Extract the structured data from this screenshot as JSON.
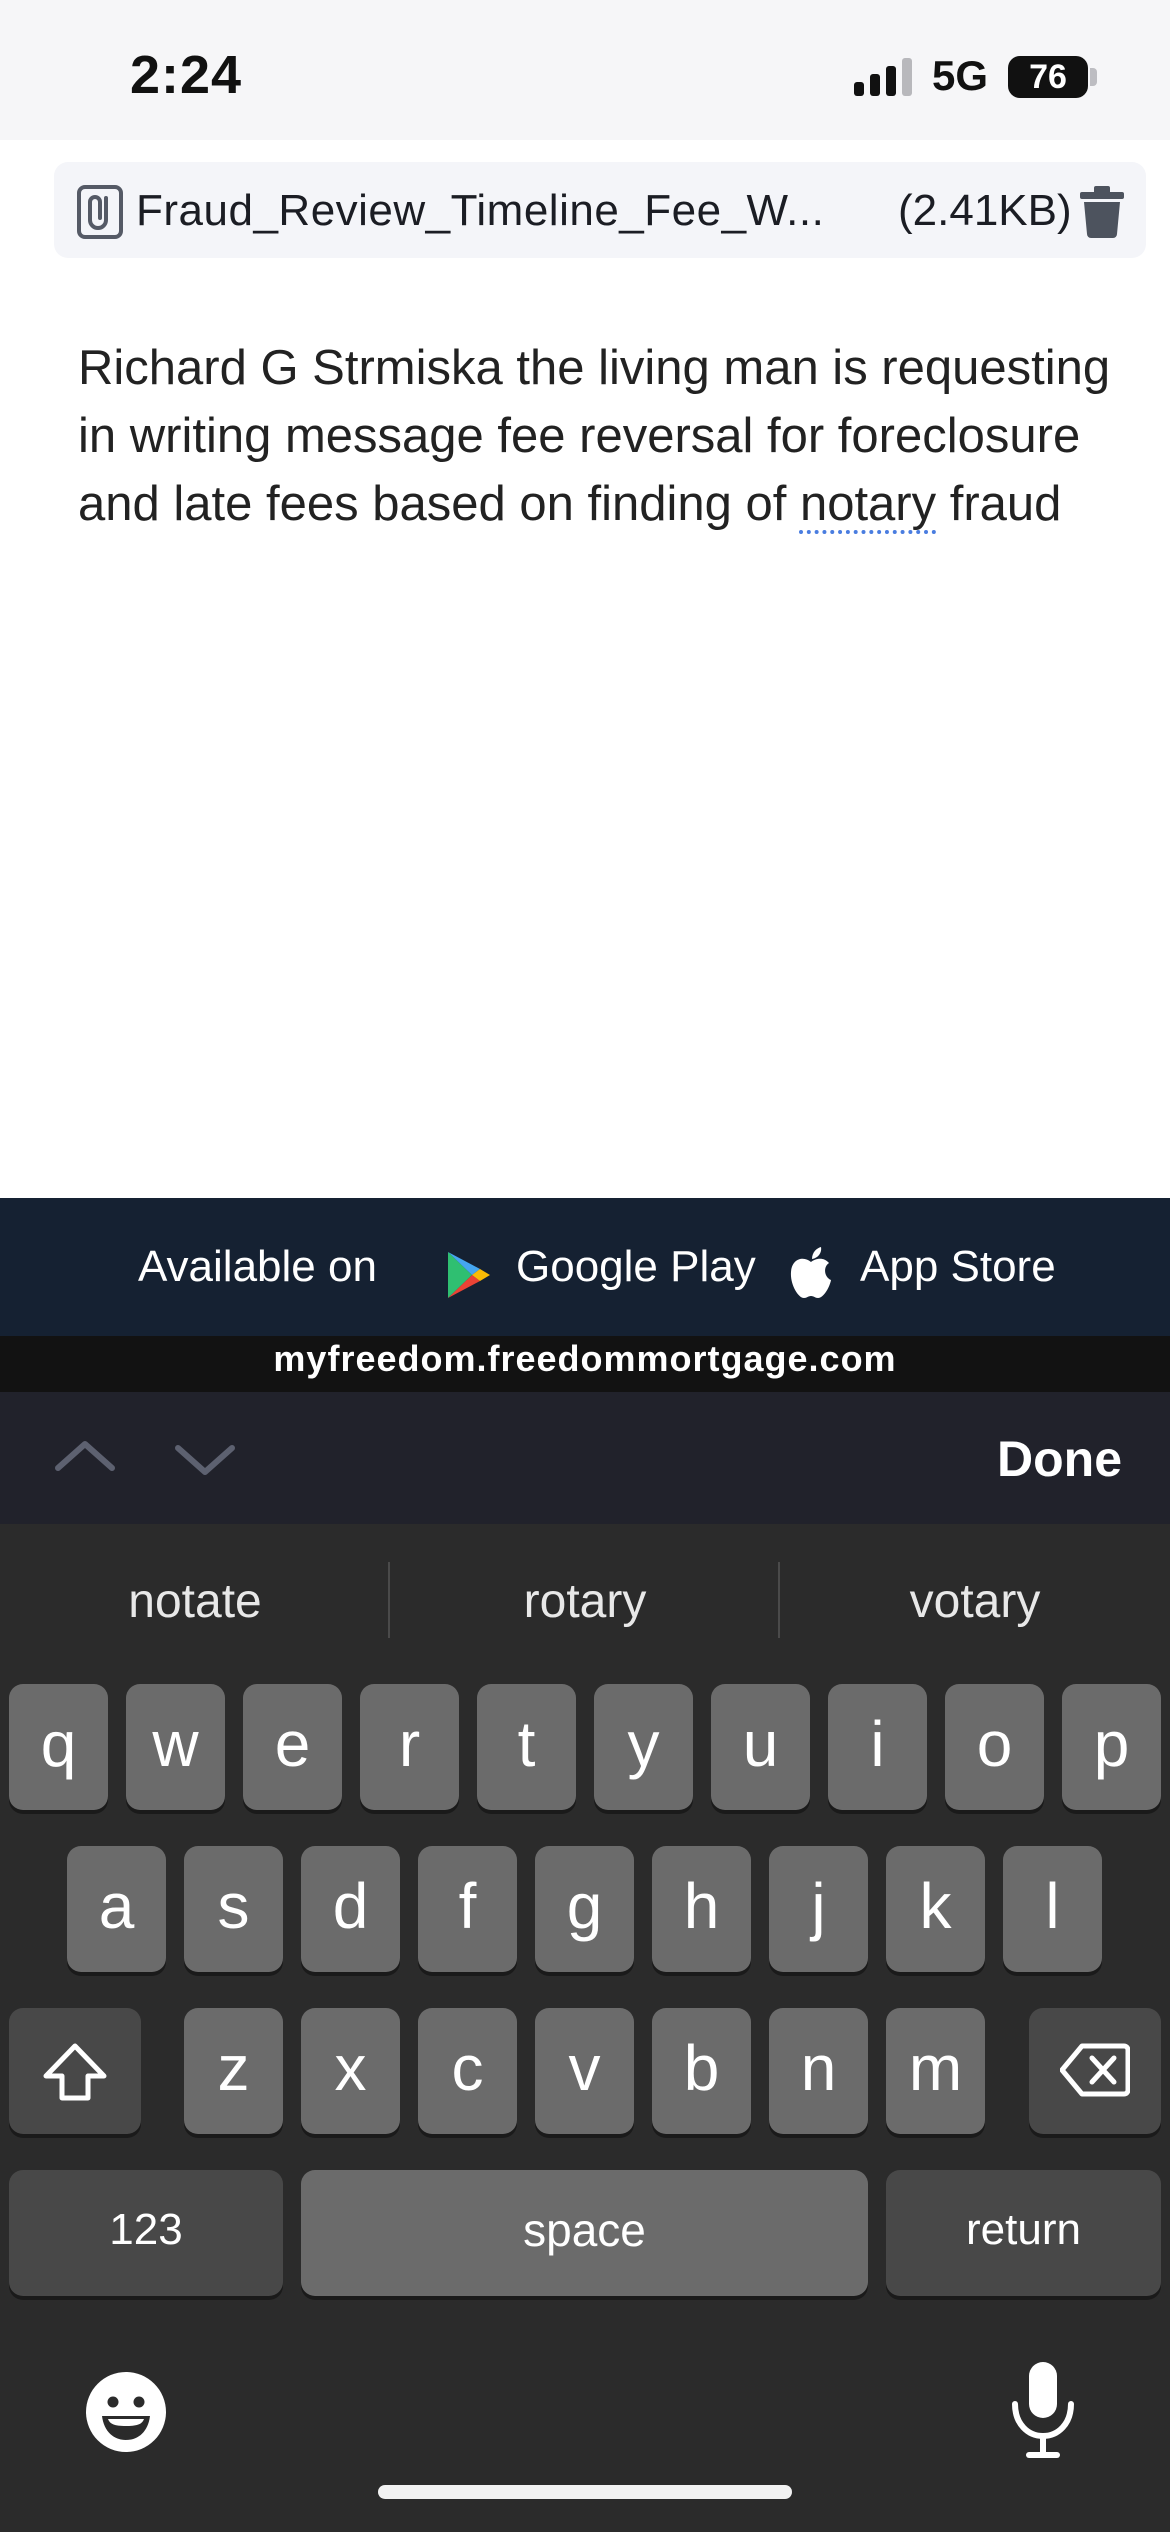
{
  "status_bar": {
    "time": "2:24",
    "network": "5G",
    "battery": "76"
  },
  "attachment": {
    "filename": "Fraud_Review_Timeline_Fee_W...",
    "size": "(2.41KB)"
  },
  "message": {
    "before": "Richard G Strmiska the living man is requesting in writing message fee reversal for foreclosure and late fees based on finding of ",
    "flagged_word": "notary",
    "after": " fraud"
  },
  "app_banner": {
    "available_on": "Available on",
    "google_play": "Google Play",
    "app_store": "App Store"
  },
  "url": "myfreedom.freedommortgage.com",
  "form_toolbar": {
    "done": "Done"
  },
  "keyboard": {
    "suggestions": [
      "notate",
      "rotary",
      "votary"
    ],
    "row1": [
      "q",
      "w",
      "e",
      "r",
      "t",
      "y",
      "u",
      "i",
      "o",
      "p"
    ],
    "row2": [
      "a",
      "s",
      "d",
      "f",
      "g",
      "h",
      "j",
      "k",
      "l"
    ],
    "row3": [
      "z",
      "x",
      "c",
      "v",
      "b",
      "n",
      "m"
    ],
    "numbers_key": "123",
    "space_key": "space",
    "return_key": "return"
  }
}
